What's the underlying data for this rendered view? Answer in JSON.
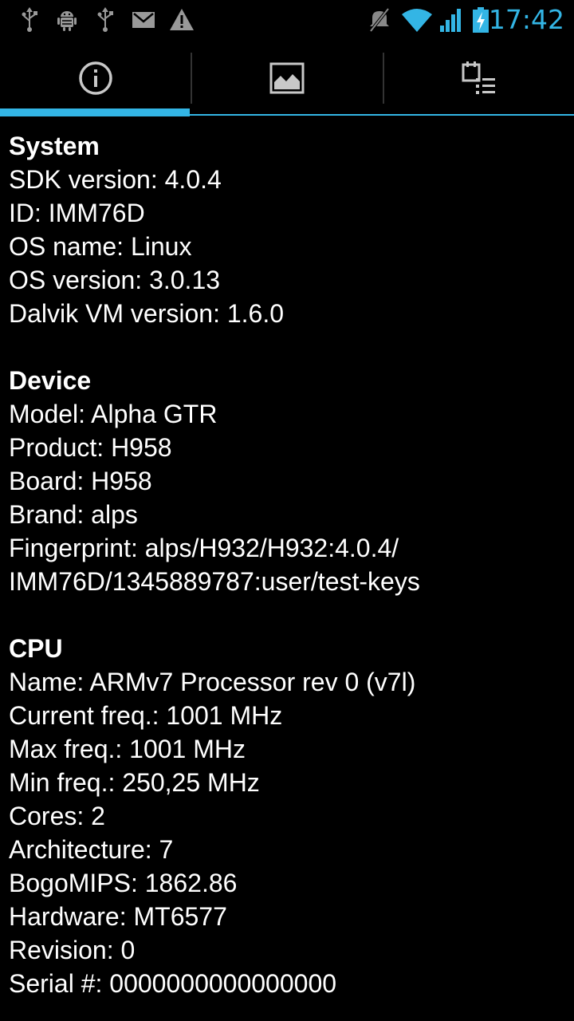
{
  "status_bar": {
    "time": "17:42",
    "icons": [
      "usb-icon",
      "android-debug-icon",
      "usb-icon",
      "gmail-icon",
      "warning-icon",
      "mute-icon",
      "wifi-icon",
      "signal-icon",
      "battery-charging-icon"
    ],
    "accent_color": "#33b5e5"
  },
  "tabs": [
    {
      "name": "info",
      "icon": "info-icon",
      "selected": true
    },
    {
      "name": "display",
      "icon": "image-icon",
      "selected": false
    },
    {
      "name": "features",
      "icon": "calendar-list-icon",
      "selected": false
    }
  ],
  "sections": {
    "system": {
      "title": "System",
      "lines": [
        "SDK version: 4.0.4",
        "ID: IMM76D",
        "OS name: Linux",
        "OS version: 3.0.13",
        "Dalvik VM version: 1.6.0"
      ]
    },
    "device": {
      "title": "Device",
      "lines": [
        "Model: Alpha GTR",
        "Product: H958",
        "Board: H958",
        "Brand: alps",
        "Fingerprint: alps/H932/H932:4.0.4/",
        "IMM76D/1345889787:user/test-keys"
      ]
    },
    "cpu": {
      "title": "CPU",
      "lines": [
        "Name: ARMv7 Processor rev 0 (v7l)",
        "Current freq.: 1001 MHz",
        "Max freq.: 1001 MHz",
        "Min freq.: 250,25 MHz",
        "Cores: 2",
        "Architecture: 7",
        "BogoMIPS: 1862.86",
        "Hardware: MT6577",
        "Revision: 0",
        "Serial #: 0000000000000000"
      ]
    }
  }
}
